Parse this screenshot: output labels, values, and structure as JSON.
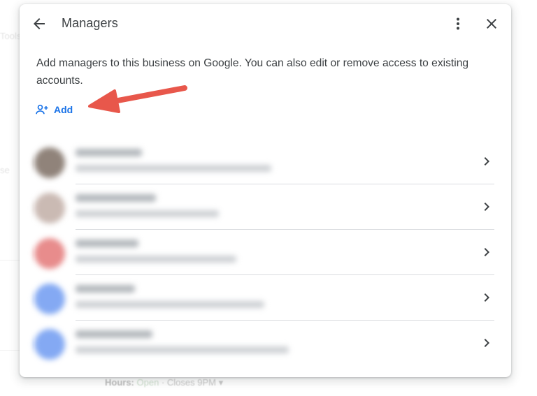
{
  "dialog": {
    "title": "Managers",
    "description": "Add managers to this business on Google. You can also edit or remove access to existing accounts.",
    "add_label": "Add"
  },
  "managers": [
    {
      "avatar_color": "#6b5a4e"
    },
    {
      "avatar_color": "#b9a39a"
    },
    {
      "avatar_color": "#e06666"
    },
    {
      "avatar_color": "#5b8def"
    },
    {
      "avatar_color": "#5b8def"
    }
  ],
  "background": {
    "hours_label": "Hours:",
    "hours_status": "Open",
    "hours_closes": "· Closes 9PM ▾"
  },
  "colors": {
    "accent": "#1a73e8",
    "arrow": "#e8574b"
  }
}
